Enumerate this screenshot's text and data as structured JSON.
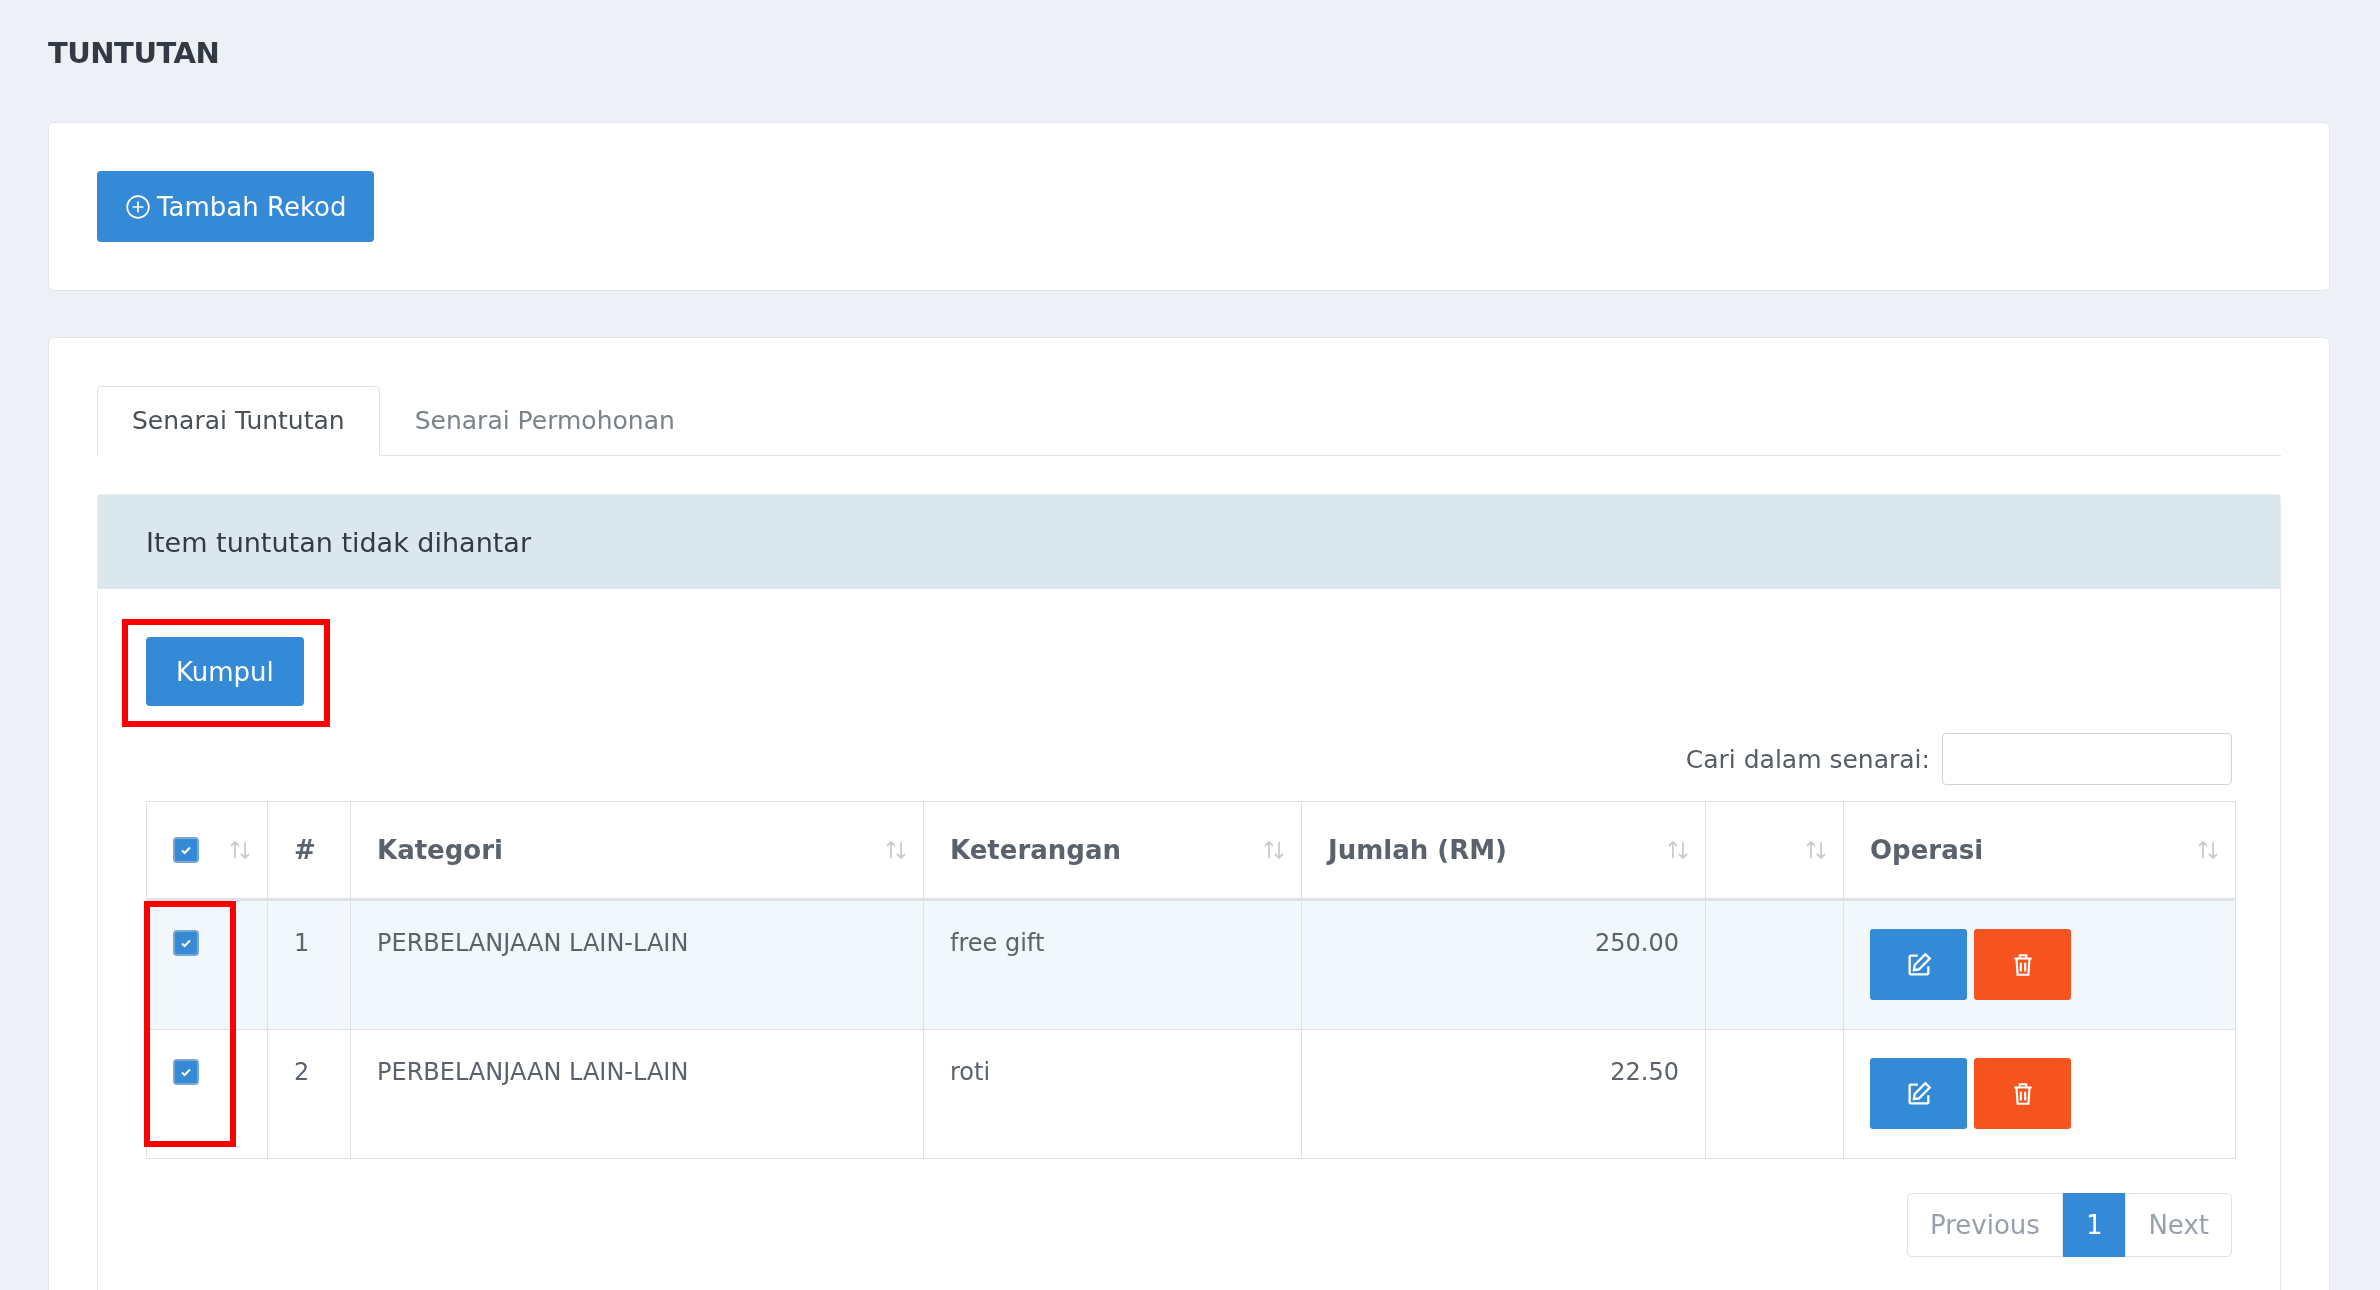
{
  "page_title": "TUNTUTAN",
  "add_button": {
    "label": "Tambah Rekod"
  },
  "tabs": [
    {
      "label": "Senarai Tuntutan",
      "selected": true
    },
    {
      "label": "Senarai Permohonan",
      "selected": false
    }
  ],
  "panel": {
    "title": "Item tuntutan tidak dihantar",
    "submit_button": {
      "label": "Kumpul",
      "highlighted": true
    },
    "search": {
      "label": "Cari dalam senarai:"
    },
    "checkbox_column_highlighted": true,
    "select_all_checked": true,
    "columns": [
      {},
      {
        "label": "#"
      },
      {
        "label": "Kategori"
      },
      {
        "label": "Keterangan"
      },
      {
        "label": "Jumlah (RM)"
      },
      {},
      {
        "label": "Operasi"
      }
    ],
    "rows": [
      {
        "checked": true,
        "no": "1",
        "kategori": "PERBELANJAAN LAIN-LAIN",
        "keterangan": "free gift",
        "jumlah": "250.00"
      },
      {
        "checked": true,
        "no": "2",
        "kategori": "PERBELANJAAN LAIN-LAIN",
        "keterangan": "roti",
        "jumlah": "22.50"
      }
    ],
    "pagination": [
      {
        "label": "Previous",
        "selected": false
      },
      {
        "label": "1",
        "selected": true
      },
      {
        "label": "Next",
        "selected": false
      }
    ]
  }
}
